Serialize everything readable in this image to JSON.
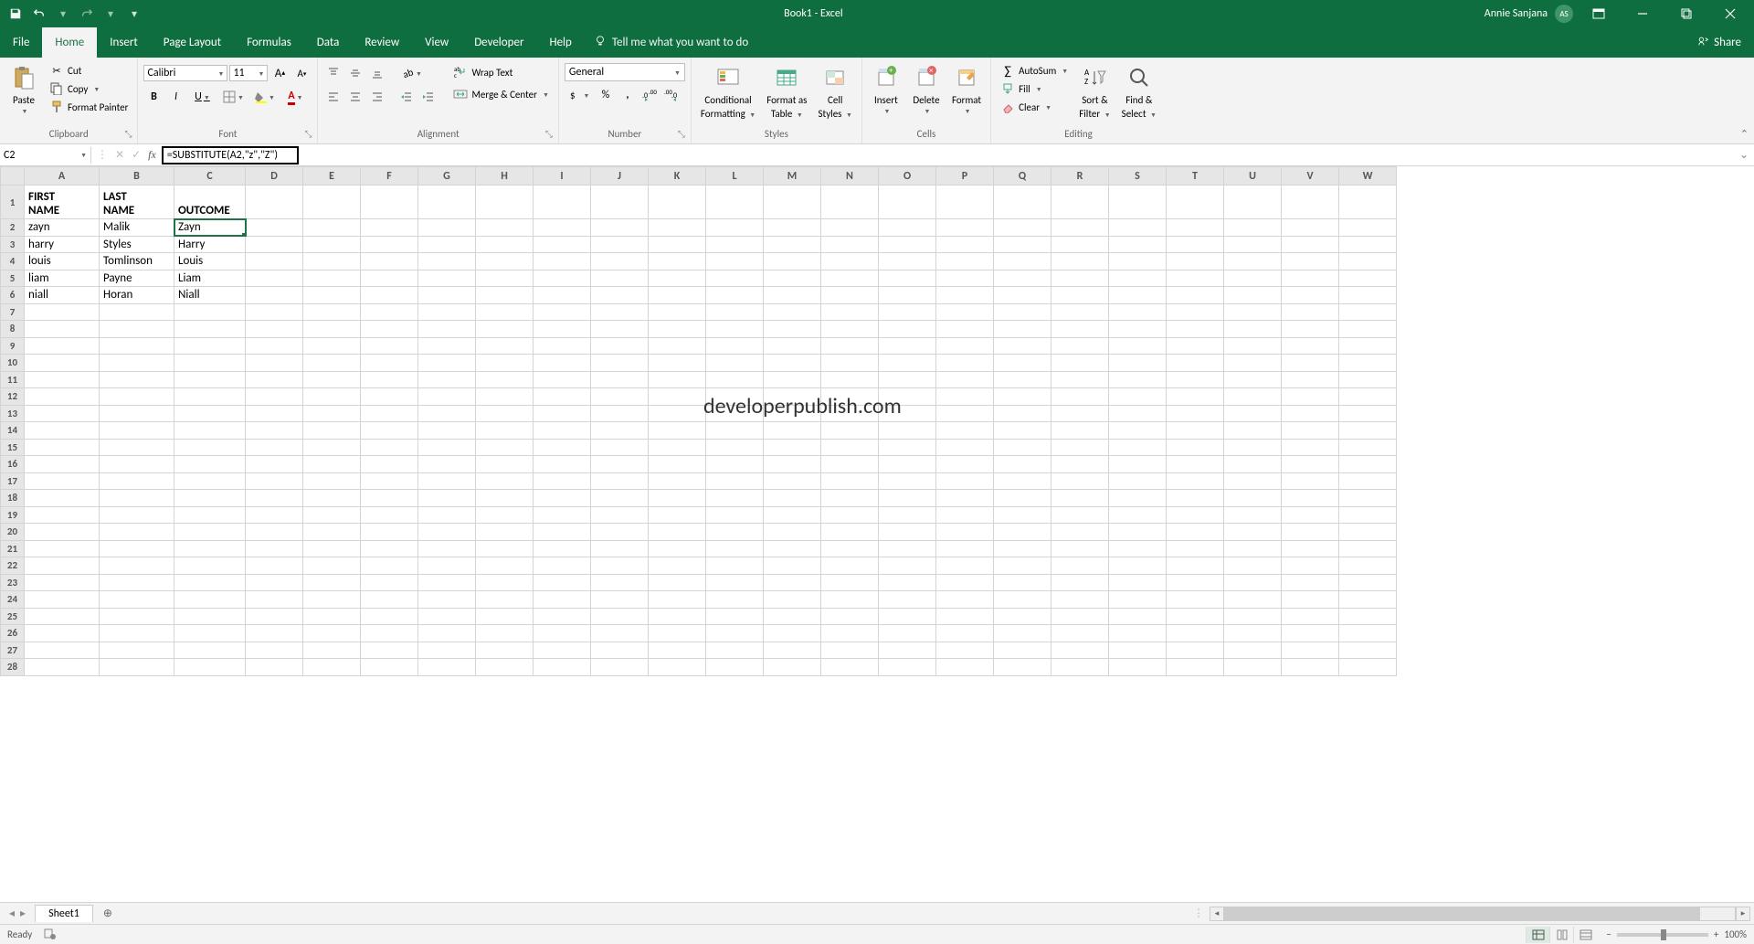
{
  "title": "Book1 - Excel",
  "user": {
    "name": "Annie Sanjana",
    "initials": "AS"
  },
  "qat": {
    "save": "save",
    "undo": "undo",
    "redo": "redo"
  },
  "tabs": {
    "file": "File",
    "home": "Home",
    "insert": "Insert",
    "pageLayout": "Page Layout",
    "formulas": "Formulas",
    "data": "Data",
    "review": "Review",
    "view": "View",
    "developer": "Developer",
    "help": "Help",
    "tellme": "Tell me what you want to do"
  },
  "share": "Share",
  "ribbon": {
    "clipboard": {
      "paste": "Paste",
      "cut": "Cut",
      "copy": "Copy",
      "formatPainter": "Format Painter",
      "label": "Clipboard"
    },
    "font": {
      "name": "Calibri",
      "size": "11",
      "bold": "B",
      "italic": "I",
      "underline": "U",
      "label": "Font"
    },
    "alignment": {
      "wrap": "Wrap Text",
      "merge": "Merge & Center",
      "label": "Alignment"
    },
    "number": {
      "format": "General",
      "label": "Number"
    },
    "styles": {
      "cond": "Conditional",
      "cond2": "Formatting",
      "fmt": "Format as",
      "fmt2": "Table",
      "cell": "Cell",
      "cell2": "Styles",
      "label": "Styles"
    },
    "cells": {
      "insert": "Insert",
      "delete": "Delete",
      "format": "Format",
      "label": "Cells"
    },
    "editing": {
      "autosum": "AutoSum",
      "fill": "Fill",
      "clear": "Clear",
      "sort": "Sort &",
      "sort2": "Filter",
      "find": "Find &",
      "find2": "Select",
      "label": "Editing"
    }
  },
  "nameBox": "C2",
  "formula": "=SUBSTITUTE(A2,\"z\",\"Z\")",
  "columns": [
    "A",
    "B",
    "C",
    "D",
    "E",
    "F",
    "G",
    "H",
    "I",
    "J",
    "K",
    "L",
    "M",
    "N",
    "O",
    "P",
    "Q",
    "R",
    "S",
    "T",
    "U",
    "V",
    "W"
  ],
  "rowHeaders": [
    "1",
    "2",
    "3",
    "4",
    "5",
    "6",
    "7",
    "8",
    "9",
    "10",
    "11",
    "12",
    "13",
    "14",
    "15",
    "16",
    "17",
    "18",
    "19",
    "20",
    "21",
    "22",
    "23",
    "24",
    "25",
    "26",
    "27",
    "28"
  ],
  "cells": {
    "A1": "FIRST NAME",
    "B1": "LAST NAME",
    "C1": "OUTCOME",
    "A2": "zayn",
    "B2": "Malik",
    "C2": "Zayn",
    "A3": "harry",
    "B3": "Styles",
    "C3": "Harry",
    "A4": "louis",
    "B4": "Tomlinson",
    "C4": "Louis",
    "A5": "liam",
    "B5": "Payne",
    "C5": "Liam",
    "A6": "niall",
    "B6": "Horan",
    "C6": "Niall"
  },
  "watermark": "developerpublish.com",
  "sheet": {
    "name": "Sheet1"
  },
  "status": {
    "ready": "Ready",
    "zoom": "100%"
  }
}
